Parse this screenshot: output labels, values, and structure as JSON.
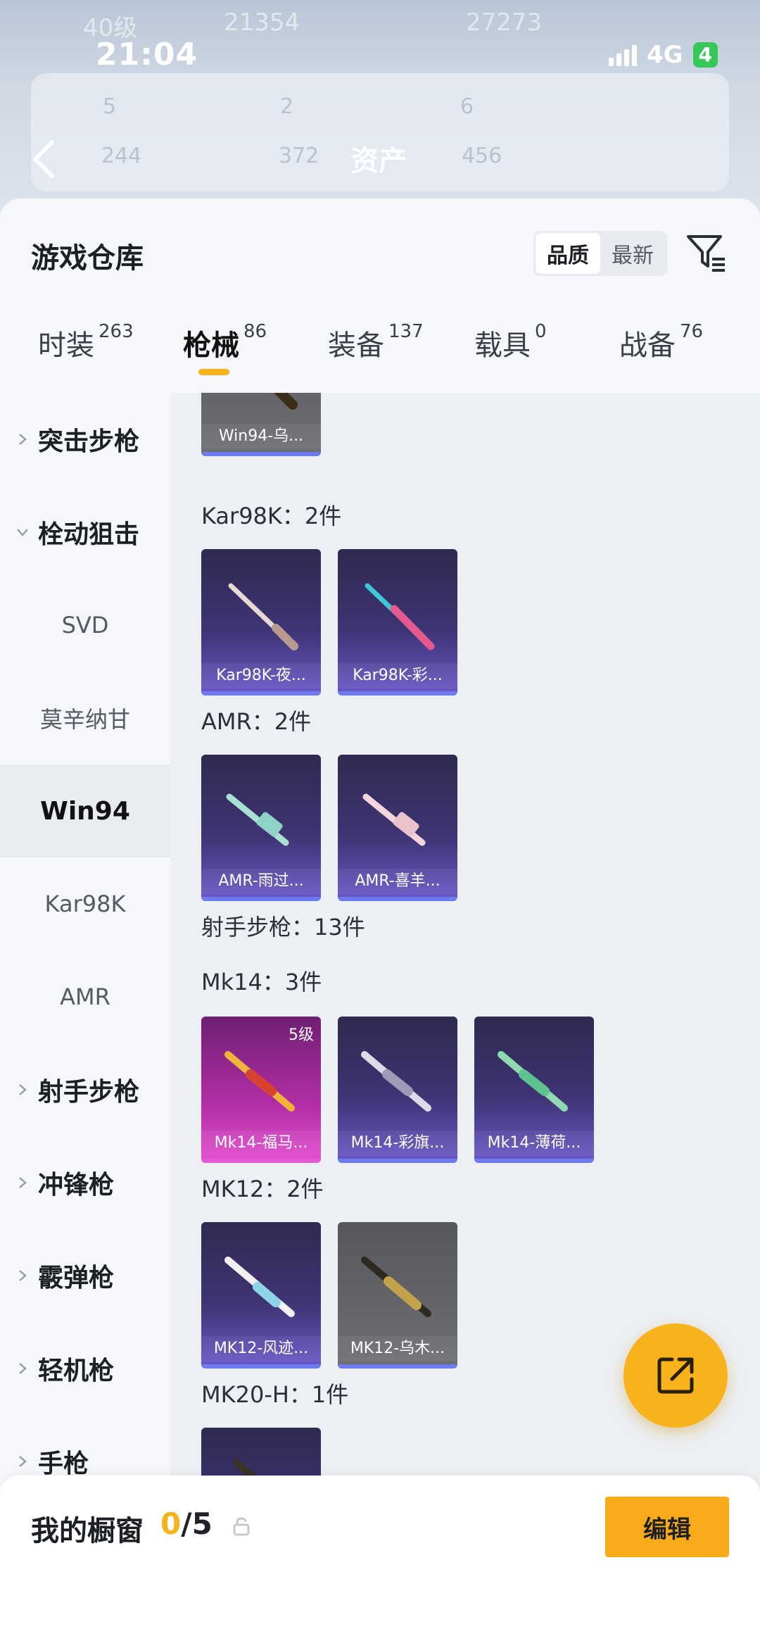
{
  "status_bar": {
    "time": "21:04",
    "network": "4G",
    "battery": "4"
  },
  "background_header": {
    "blurred_top": [
      "40级",
      "21354",
      "27273"
    ],
    "row1": [
      "5",
      "2",
      "6"
    ],
    "row2": [
      "244",
      "372",
      "456"
    ],
    "title": "资产"
  },
  "sheet": {
    "title": "游戏仓库",
    "sort_options": [
      "品质",
      "最新"
    ],
    "sort_selected": "品质"
  },
  "tabs": [
    {
      "label": "时装",
      "count": "263"
    },
    {
      "label": "枪械",
      "count": "86",
      "active": true
    },
    {
      "label": "装备",
      "count": "137"
    },
    {
      "label": "载具",
      "count": "0"
    },
    {
      "label": "战备",
      "count": "76"
    }
  ],
  "sidebar": [
    {
      "label": "突击步枪",
      "type": "group",
      "expanded": false
    },
    {
      "label": "栓动狙击",
      "type": "group",
      "expanded": true
    },
    {
      "label": "SVD",
      "type": "sub"
    },
    {
      "label": "莫辛纳甘",
      "type": "sub"
    },
    {
      "label": "Win94",
      "type": "sub",
      "active": true
    },
    {
      "label": "Kar98K",
      "type": "sub"
    },
    {
      "label": "AMR",
      "type": "sub"
    },
    {
      "label": "射手步枪",
      "type": "group",
      "expanded": false
    },
    {
      "label": "冲锋枪",
      "type": "group",
      "expanded": false
    },
    {
      "label": "霰弹枪",
      "type": "group",
      "expanded": false
    },
    {
      "label": "轻机枪",
      "type": "group",
      "expanded": false
    },
    {
      "label": "手枪",
      "type": "group",
      "expanded": false
    }
  ],
  "content": {
    "win94_card": {
      "name": "Win94-乌..."
    },
    "groups": [
      {
        "label": "Kar98K：2件",
        "items": [
          {
            "name": "Kar98K-夜...",
            "style": "purple"
          },
          {
            "name": "Kar98K-彩...",
            "style": "purple"
          }
        ]
      },
      {
        "label": "AMR：2件",
        "items": [
          {
            "name": "AMR-雨过...",
            "style": "purple"
          },
          {
            "name": "AMR-喜羊...",
            "style": "purple"
          }
        ]
      },
      {
        "label": "射手步枪：13件",
        "items": []
      },
      {
        "label": "Mk14：3件",
        "items": [
          {
            "name": "Mk14-福马...",
            "style": "pink",
            "level": "5级"
          },
          {
            "name": "Mk14-彩旗...",
            "style": "purple"
          },
          {
            "name": "Mk14-薄荷...",
            "style": "purple"
          }
        ]
      },
      {
        "label": "MK12：2件",
        "items": [
          {
            "name": "MK12-风迹...",
            "style": "purple"
          },
          {
            "name": "MK12-乌木...",
            "style": "gray"
          }
        ]
      },
      {
        "label": "MK20-H：1件",
        "items": []
      }
    ]
  },
  "footer": {
    "title": "我的橱窗",
    "current": "0",
    "total": "/5",
    "edit_label": "编辑"
  },
  "colors": {
    "accent": "#f6b21a",
    "card_purple": "#3e3474",
    "card_pink": "#b22ea6"
  }
}
